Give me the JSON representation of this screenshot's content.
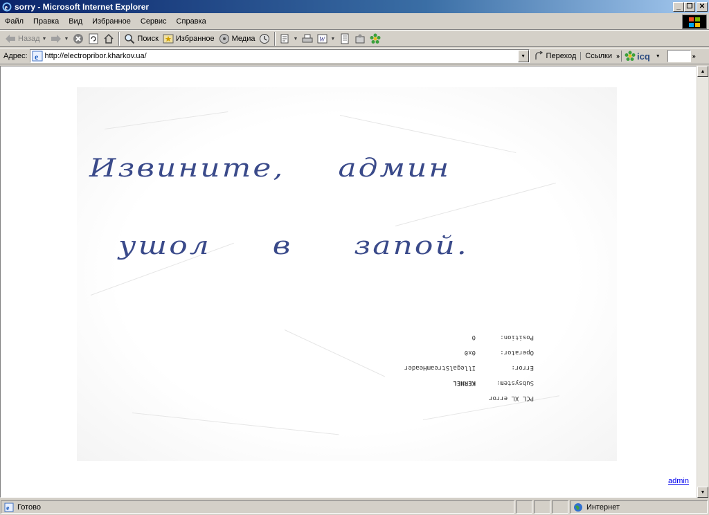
{
  "window": {
    "title": "sorry - Microsoft Internet Explorer"
  },
  "menu": {
    "items": [
      "Файл",
      "Правка",
      "Вид",
      "Избранное",
      "Сервис",
      "Справка"
    ]
  },
  "toolbar": {
    "back_label": "Назад",
    "search_label": "Поиск",
    "favorites_label": "Избранное",
    "media_label": "Медиа"
  },
  "address": {
    "label": "Адрес:",
    "url": "http://electropribor.kharkov.ua/",
    "go_label": "Переход",
    "links_label": "Ссылки",
    "icq_label": "icq"
  },
  "page": {
    "note_line1": "Извините, админ",
    "note_line2": "ушол в запой.",
    "printer_error": {
      "title": "PCL XL error",
      "rows": [
        {
          "key": "Subsystem:",
          "value": "KERNEL"
        },
        {
          "key": "Error:",
          "value": "IllegalStreamHeader"
        },
        {
          "key": "Operator:",
          "value": "0x0"
        },
        {
          "key": "Position:",
          "value": "0"
        }
      ]
    },
    "admin_link": "admin"
  },
  "status": {
    "text": "Готово",
    "zone": "Интернет"
  }
}
